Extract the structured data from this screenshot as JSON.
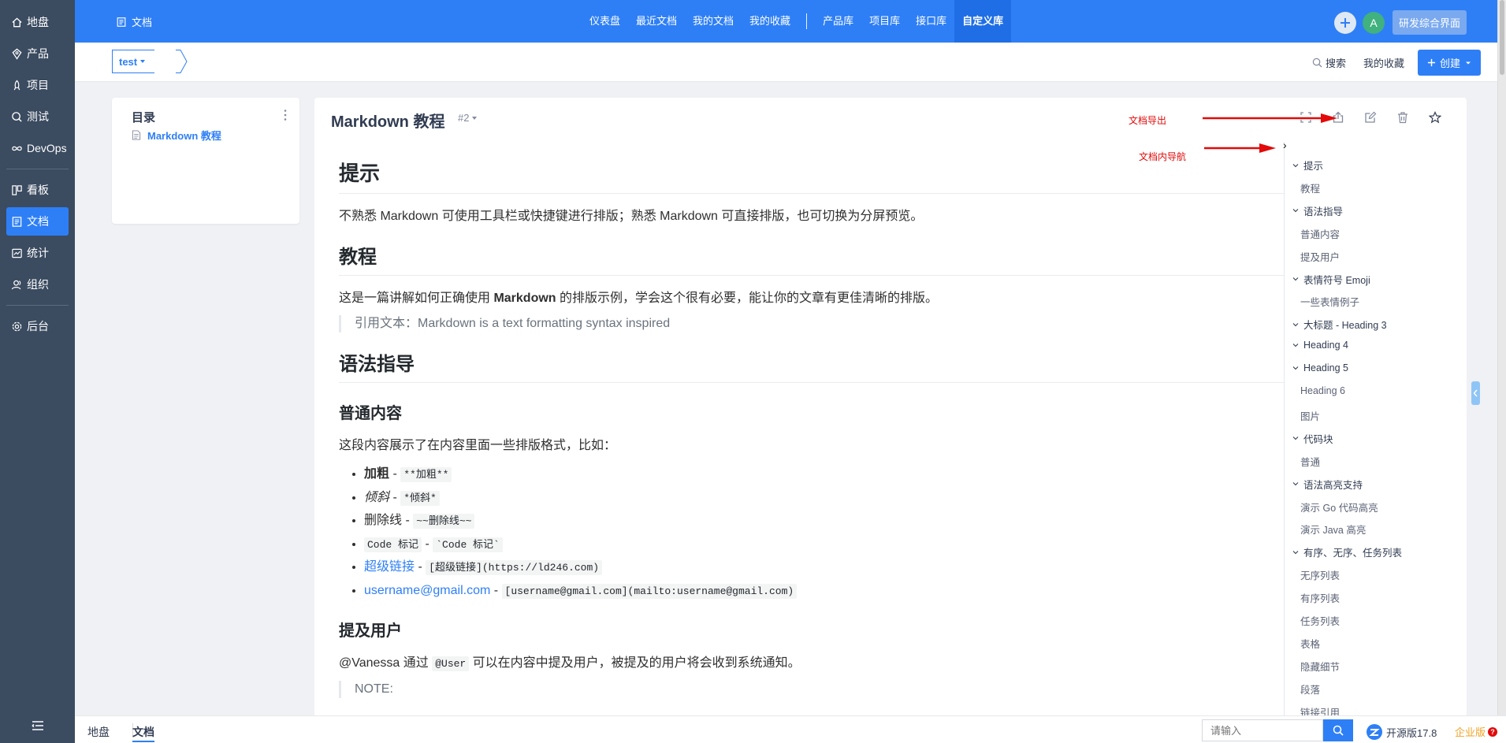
{
  "sidebar": {
    "items": [
      {
        "label": "地盘",
        "icon": "home-icon"
      },
      {
        "label": "产品",
        "icon": "product-icon"
      },
      {
        "label": "项目",
        "icon": "project-icon"
      },
      {
        "label": "测试",
        "icon": "test-icon"
      },
      {
        "label": "DevOps",
        "icon": "infinity-icon"
      },
      {
        "label": "看板",
        "icon": "kanban-icon"
      },
      {
        "label": "文档",
        "icon": "doc-icon",
        "active": true
      },
      {
        "label": "统计",
        "icon": "chart-icon"
      },
      {
        "label": "组织",
        "icon": "people-icon"
      },
      {
        "label": "后台",
        "icon": "gear-icon"
      }
    ]
  },
  "topbar": {
    "app_name": "文档",
    "nav": [
      "仪表盘",
      "最近文档",
      "我的文档",
      "我的收藏",
      "产品库",
      "项目库",
      "接口库",
      "自定义库"
    ],
    "active_nav": "自定义库",
    "avatar_letter": "A",
    "vision_label": "研发综合界面"
  },
  "subbar": {
    "library": "test",
    "search_label": "搜索",
    "favorites_label": "我的收藏",
    "create_label": "创建"
  },
  "toc": {
    "title": "目录",
    "item": "Markdown 教程"
  },
  "doc": {
    "title": "Markdown 教程",
    "version": "#2",
    "annotations": {
      "export": "文档导出",
      "nav": "文档内导航"
    }
  },
  "content": {
    "h1": "提示",
    "p1": "不熟悉 Markdown 可使用工具栏或快捷键进行排版；熟悉 Markdown 可直接排版，也可切换为分屏预览。",
    "h2_tutorial": "教程",
    "p2_pre": "这是一篇讲解如何正确使用 ",
    "p2_bold": "Markdown",
    "p2_post": " 的排版示例，学会这个很有必要，能让你的文章有更佳清晰的排版。",
    "quote1": "引用文本：Markdown is a text formatting syntax inspired",
    "h2_syntax": "语法指导",
    "h3_normal": "普通内容",
    "p3": "这段内容展示了在内容里面一些排版格式，比如：",
    "list": {
      "bold_text": "加粗",
      "bold_code": "**加粗**",
      "italic_text": "倾斜",
      "italic_code": "*倾斜*",
      "strike_text": "删除线",
      "strike_code": "~~删除线~~",
      "code_text": "Code 标记",
      "code_code": "`Code 标记`",
      "link_text": "超级链接",
      "link_code": "[超级链接](https://ld246.com)",
      "mail_text": "username@gmail.com",
      "mail_code": "[username@gmail.com](mailto:username@gmail.com)",
      "dash": "-"
    },
    "h3_mention": "提及用户",
    "p4_pre": "@Vanessa 通过 ",
    "p4_code": "@User",
    "p4_post": " 可以在内容中提及用户，被提及的用户将会收到系统通知。",
    "quote2": "NOTE:"
  },
  "outline": [
    {
      "label": "提示",
      "level": 1
    },
    {
      "label": "教程",
      "level": 2
    },
    {
      "label": "语法指导",
      "level": 1
    },
    {
      "label": "普通内容",
      "level": 2
    },
    {
      "label": "提及用户",
      "level": 2
    },
    {
      "label": "表情符号 Emoji",
      "level": 1
    },
    {
      "label": "一些表情例子",
      "level": 2
    },
    {
      "label": "大标题 - Heading 3",
      "level": 1
    },
    {
      "label": "Heading 4",
      "level": 1
    },
    {
      "label": "Heading 5",
      "level": 1
    },
    {
      "label": "Heading 6",
      "level": 2
    },
    {
      "label": "图片",
      "level": 2
    },
    {
      "label": "代码块",
      "level": 1
    },
    {
      "label": "普通",
      "level": 2
    },
    {
      "label": "语法高亮支持",
      "level": 1
    },
    {
      "label": "演示 Go 代码高亮",
      "level": 2
    },
    {
      "label": "演示 Java 高亮",
      "level": 2
    },
    {
      "label": "有序、无序、任务列表",
      "level": 1
    },
    {
      "label": "无序列表",
      "level": 2
    },
    {
      "label": "有序列表",
      "level": 2
    },
    {
      "label": "任务列表",
      "level": 2
    },
    {
      "label": "表格",
      "level": 2
    },
    {
      "label": "隐藏细节",
      "level": 2
    },
    {
      "label": "段落",
      "level": 2
    },
    {
      "label": "链接引用",
      "level": 2
    }
  ],
  "footer": {
    "crumbs": [
      "地盘",
      "文档"
    ],
    "search_placeholder": "请输入",
    "version": "开源版17.8",
    "enterprise": "企业版",
    "enterprise_help": "?"
  },
  "colors": {
    "primary": "#2e7ff6",
    "sidebar": "#3b4b60",
    "annotation": "#e20a0a"
  }
}
